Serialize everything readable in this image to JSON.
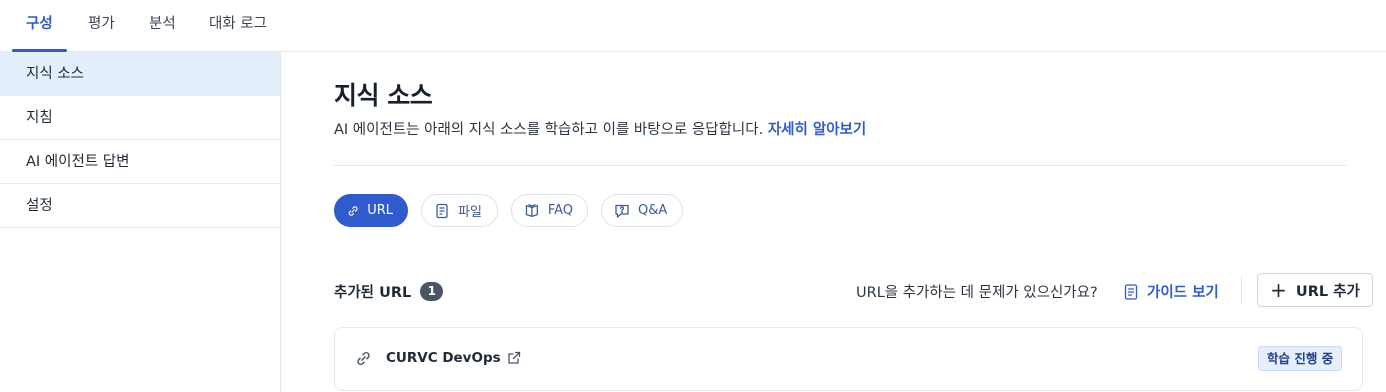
{
  "tabs": [
    {
      "label": "구성",
      "active": true
    },
    {
      "label": "평가",
      "active": false
    },
    {
      "label": "분석",
      "active": false
    },
    {
      "label": "대화 로그",
      "active": false
    }
  ],
  "sidebar": {
    "items": [
      {
        "label": "지식 소스",
        "active": true
      },
      {
        "label": "지침",
        "active": false
      },
      {
        "label": "AI 에이전트 답변",
        "active": false
      },
      {
        "label": "설정",
        "active": false
      }
    ]
  },
  "main": {
    "title": "지식 소스",
    "description": "AI 에이전트는 아래의 지식 소스를 학습하고 이를 바탕으로 응답합니다.",
    "learn_more": "자세히 알아보기",
    "source_types": [
      {
        "label": "URL",
        "icon": "link-icon",
        "active": true
      },
      {
        "label": "파일",
        "icon": "file-icon",
        "active": false
      },
      {
        "label": "FAQ",
        "icon": "book-icon",
        "active": false
      },
      {
        "label": "Q&A",
        "icon": "chat-icon",
        "active": false
      }
    ],
    "added_label": "추가된 URL",
    "added_count": "1",
    "help_text": "URL을 추가하는 데 문제가 있으신가요?",
    "guide_label": "가이드 보기",
    "add_button_label": "URL 추가",
    "urls": [
      {
        "name": "CURVC DevOps",
        "status": "학습 진행 중"
      }
    ]
  },
  "colors": {
    "accent": "#2f5bcd",
    "active_sidebar_bg": "#e4effc",
    "badge_bg": "#4a5564",
    "status_bg": "#e5eefb"
  }
}
